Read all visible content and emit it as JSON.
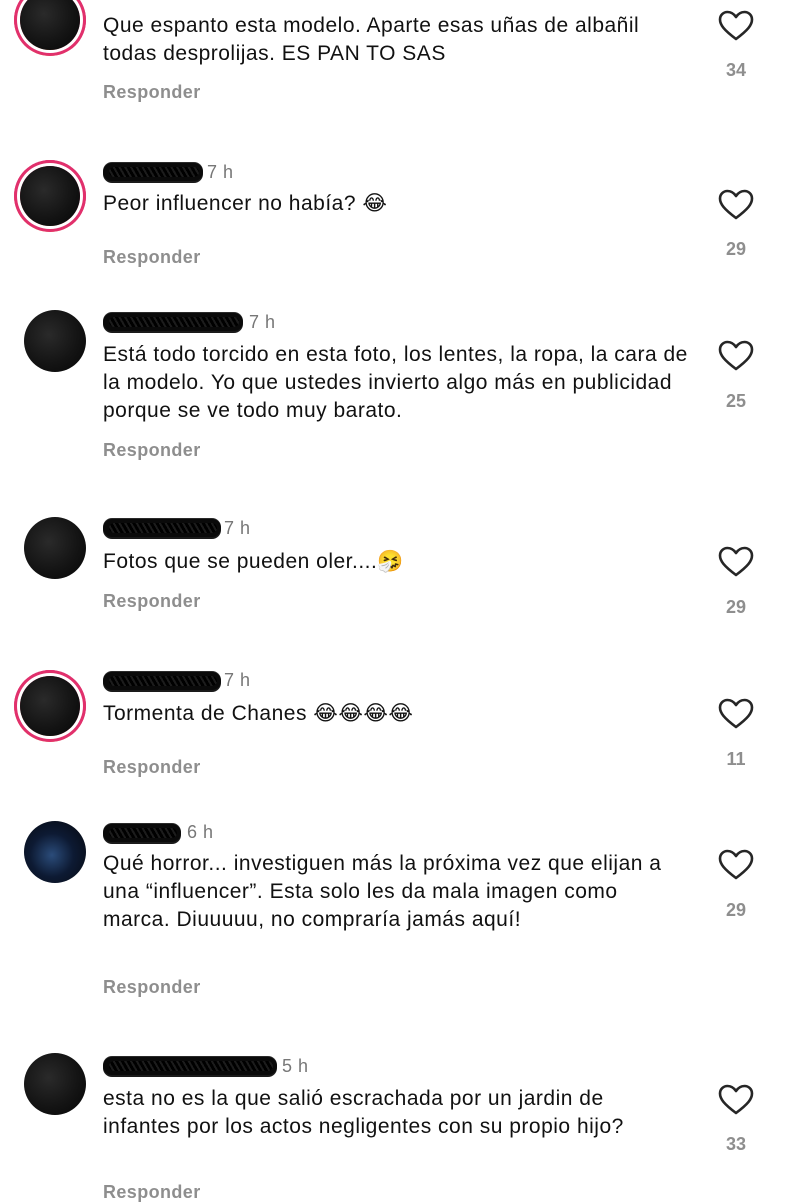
{
  "comments": [
    {
      "time": "",
      "text": "Que espanto esta modelo. Aparte esas uñas de albañil todas desprolijas. ES PAN TO SAS",
      "reply_label": "Responder",
      "likes": "34"
    },
    {
      "time": "7 h",
      "text": "Peor influencer no había? 😂",
      "reply_label": "Responder",
      "likes": "29"
    },
    {
      "time": "7 h",
      "text": "Está todo torcido en esta foto, los lentes, la ropa, la cara de la modelo. Yo que ustedes invierto algo más en publicidad porque se ve todo muy barato.",
      "reply_label": "Responder",
      "likes": "25"
    },
    {
      "time": "7 h",
      "text": "Fotos que se pueden oler....🤧",
      "reply_label": "Responder",
      "likes": "29"
    },
    {
      "time": "7 h",
      "text": "Tormenta de Chanes 😂😂😂😂",
      "reply_label": "Responder",
      "likes": "11"
    },
    {
      "time": "6 h",
      "text": "Qué horror... investiguen más la próxima vez que elijan a una “influencer”. Esta solo les da mala imagen como marca. Diuuuuu, no compraría jamás aquí!",
      "reply_label": "Responder",
      "likes": "29"
    },
    {
      "time": "5 h",
      "text": "esta no es la que salió escrachada por un jardin de infantes por los actos negligentes con su propio hijo?",
      "reply_label": "Responder",
      "likes": "33"
    }
  ],
  "icons": {
    "like": "heart-outline-icon"
  },
  "colors": {
    "story_ring_start": "#f9ce34",
    "story_ring_end": "#ee2a7b",
    "secondary_text": "#8e8e8e"
  }
}
